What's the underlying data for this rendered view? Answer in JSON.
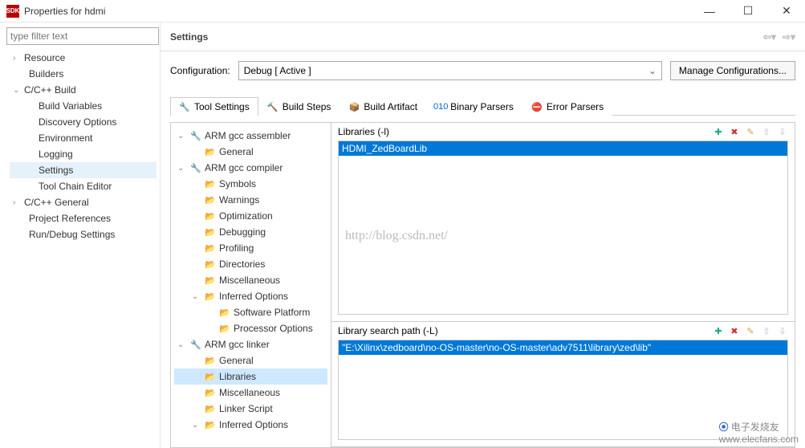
{
  "window": {
    "title": "Properties for hdmi",
    "icon_text": "SDK"
  },
  "filter_placeholder": "type filter text",
  "nav": [
    {
      "label": "Resource",
      "expand": ">",
      "level": 0
    },
    {
      "label": "Builders",
      "expand": "",
      "level": 1
    },
    {
      "label": "C/C++ Build",
      "expand": "v",
      "level": 0
    },
    {
      "label": "Build Variables",
      "expand": "",
      "level": 2
    },
    {
      "label": "Discovery Options",
      "expand": "",
      "level": 2
    },
    {
      "label": "Environment",
      "expand": "",
      "level": 2
    },
    {
      "label": "Logging",
      "expand": "",
      "level": 2
    },
    {
      "label": "Settings",
      "expand": "",
      "level": 2,
      "selected": true
    },
    {
      "label": "Tool Chain Editor",
      "expand": "",
      "level": 2
    },
    {
      "label": "C/C++ General",
      "expand": ">",
      "level": 0
    },
    {
      "label": "Project References",
      "expand": "",
      "level": 1
    },
    {
      "label": "Run/Debug Settings",
      "expand": "",
      "level": 1
    }
  ],
  "page_header": "Settings",
  "config_label": "Configuration:",
  "config_value": "Debug  [ Active ]",
  "manage_label": "Manage Configurations...",
  "tabs": [
    {
      "label": "Tool Settings",
      "active": true
    },
    {
      "label": "Build Steps",
      "active": false
    },
    {
      "label": "Build Artifact",
      "active": false
    },
    {
      "label": "Binary Parsers",
      "active": false
    },
    {
      "label": "Error Parsers",
      "active": false
    }
  ],
  "tool_tree": [
    {
      "label": "ARM gcc assembler",
      "l": 1,
      "tw": "v",
      "icon": "wrench"
    },
    {
      "label": "General",
      "l": 2,
      "tw": "",
      "icon": "folder"
    },
    {
      "label": "ARM gcc compiler",
      "l": 1,
      "tw": "v",
      "icon": "wrench"
    },
    {
      "label": "Symbols",
      "l": 2,
      "tw": "",
      "icon": "folder"
    },
    {
      "label": "Warnings",
      "l": 2,
      "tw": "",
      "icon": "folder"
    },
    {
      "label": "Optimization",
      "l": 2,
      "tw": "",
      "icon": "folder"
    },
    {
      "label": "Debugging",
      "l": 2,
      "tw": "",
      "icon": "folder"
    },
    {
      "label": "Profiling",
      "l": 2,
      "tw": "",
      "icon": "folder"
    },
    {
      "label": "Directories",
      "l": 2,
      "tw": "",
      "icon": "folder"
    },
    {
      "label": "Miscellaneous",
      "l": 2,
      "tw": "",
      "icon": "folder"
    },
    {
      "label": "Inferred Options",
      "l": 2,
      "tw": "v",
      "icon": "folder"
    },
    {
      "label": "Software Platform",
      "l": 3,
      "tw": "",
      "icon": "folder"
    },
    {
      "label": "Processor Options",
      "l": 3,
      "tw": "",
      "icon": "folder"
    },
    {
      "label": "ARM gcc linker",
      "l": 1,
      "tw": "v",
      "icon": "wrench"
    },
    {
      "label": "General",
      "l": 2,
      "tw": "",
      "icon": "folder"
    },
    {
      "label": "Libraries",
      "l": 2,
      "tw": "",
      "icon": "folder",
      "sel": true
    },
    {
      "label": "Miscellaneous",
      "l": 2,
      "tw": "",
      "icon": "folder"
    },
    {
      "label": "Linker Script",
      "l": 2,
      "tw": "",
      "icon": "folder"
    },
    {
      "label": "Inferred Options",
      "l": 2,
      "tw": "v",
      "icon": "folder"
    }
  ],
  "libs_label": "Libraries (-l)",
  "libs_item": "HDMI_ZedBoardLib",
  "path_label": "Library search path (-L)",
  "path_item": "\"E:\\Xilinx\\zedboard\\no-OS-master\\no-OS-master\\adv7511\\library\\zed\\lib\"",
  "watermark": "http://blog.csdn.net/",
  "footer_wm_1": "电子发烧友",
  "footer_wm_2": "www.elecfans.com"
}
